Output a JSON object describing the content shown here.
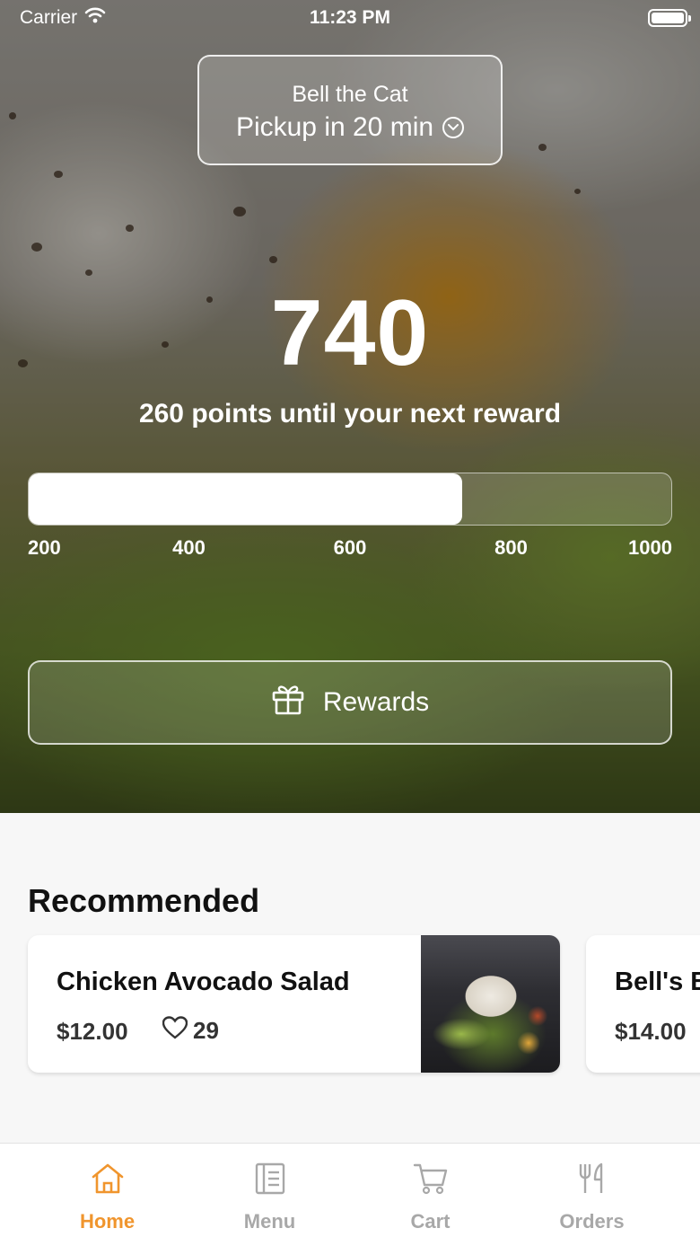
{
  "status_bar": {
    "carrier": "Carrier",
    "time": "11:23 PM"
  },
  "pickup": {
    "store_name": "Bell the Cat",
    "pickup_label": "Pickup in 20 min"
  },
  "rewards": {
    "points": "740",
    "subtitle": "260 points until your next reward",
    "progress_value": 740,
    "progress_min": 200,
    "progress_max": 1000,
    "ticks": [
      "200",
      "400",
      "600",
      "800",
      "1000"
    ],
    "button_label": "Rewards"
  },
  "recommended": {
    "title": "Recommended",
    "items": [
      {
        "name": "Chicken Avocado Salad",
        "price": "$12.00",
        "likes": "29"
      },
      {
        "name": "Bell's B",
        "price": "$14.00"
      }
    ]
  },
  "tabs": [
    {
      "label": "Home",
      "icon": "home-icon",
      "active": true
    },
    {
      "label": "Menu",
      "icon": "menu-icon",
      "active": false
    },
    {
      "label": "Cart",
      "icon": "cart-icon",
      "active": false
    },
    {
      "label": "Orders",
      "icon": "fork-knife-icon",
      "active": false
    }
  ],
  "colors": {
    "accent": "#f0952d",
    "inactive_tab": "#a8a8a8"
  }
}
